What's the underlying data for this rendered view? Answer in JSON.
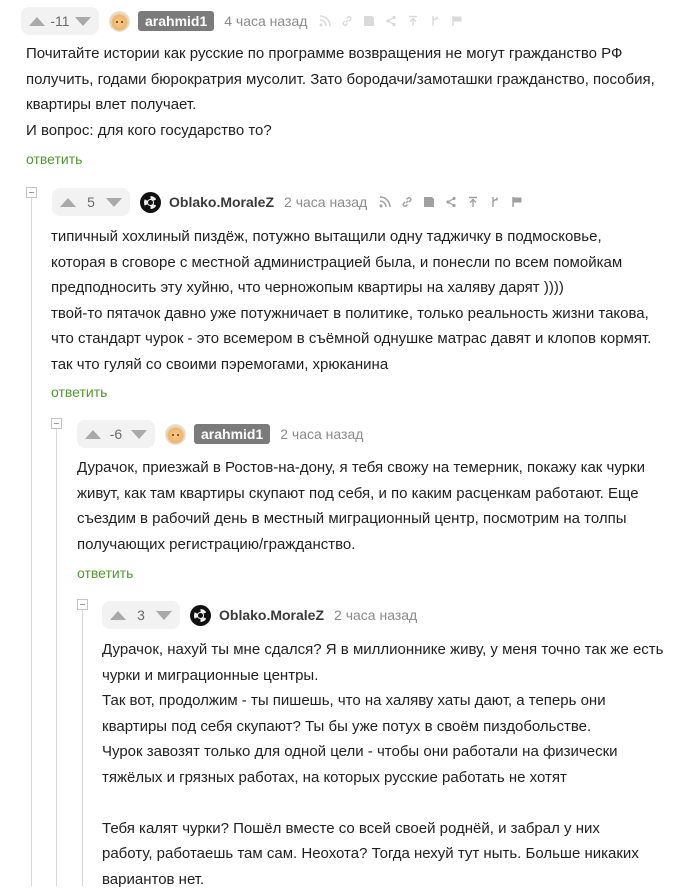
{
  "comments": [
    {
      "rating": "-11",
      "username": "arahmid1",
      "time": "4 часа назад",
      "text": "Почитайте истории как русские по программе возвращения не могут гражданство РФ\nполучить, годами бюрократрия мусолит. Зато бородачи/замоташки гражданство, пособия,\nквартиры влет получает.\nИ вопрос: для кого государство то?",
      "reply_label": "ответить",
      "avatar_icon": "bun-avatar-icon"
    },
    {
      "rating": "5",
      "username": "Oblako.MoraleZ",
      "time": "2 часа назад",
      "text": "типичный хохлиный пиздёж, потужно вытащили одну таджичку в подмосковье,\nкоторая в сговоре с местной администрацией была, и понесли по всем помойкам\nпредподносить эту хуйню, что черножопым квартиры на халяву дарят ))))\nтвой-то пятачок давно уже потужничает в политике, только реальность жизни такова,\nчто стандарт чурок - это всемером в съёмной однушке матрас давят и клопов кормят.\nтак что гуляй со своими пэремогами, хрюканина",
      "reply_label": "ответить",
      "avatar_icon": "radiation-avatar-icon"
    },
    {
      "rating": "-6",
      "username": "arahmid1",
      "time": "2 часа назад",
      "text": "Дурачок, приезжай в Ростов-на-дону, я тебя свожу на темерник, покажу как чурки\nживут, как там квартиры скупают под себя, и по каким расценкам работают. Еще\nсъездим в рабочий день в местный миграционный центр, посмотрим на толпы\nполучающих регистрацию/гражданство.",
      "reply_label": "ответить",
      "avatar_icon": "bun-avatar-icon"
    },
    {
      "rating": "3",
      "username": "Oblako.MoraleZ",
      "time": "2 часа назад",
      "text": "Дурачок, нахуй ты мне сдался? Я в миллионнике живу, у меня точно так же есть\nчурки и миграционные центры.\nТак вот, продолжим - ты пишешь, что на халяву хаты дают, а теперь они\nквартиры под себя скупают? Ты бы уже потух в своём пиздобольстве.\nЧурок завозят только для одной цели - чтобы они работали на физически\nтяжёлых и грязных работах, на которых русские работать не хотят\n\nТебя калят чурки? Пошёл вместе со всей своей роднёй, и забрал у них\nработу, работаешь там сам. Неохота? Тогда нехуй тут ныть. Больше никаких\nвариантов нет.",
      "avatar_icon": "radiation-avatar-icon"
    }
  ],
  "action_icons": [
    "rss-icon",
    "link-icon",
    "save-icon",
    "share-icon",
    "scroll-up-icon",
    "branch-icon",
    "flag-icon"
  ]
}
